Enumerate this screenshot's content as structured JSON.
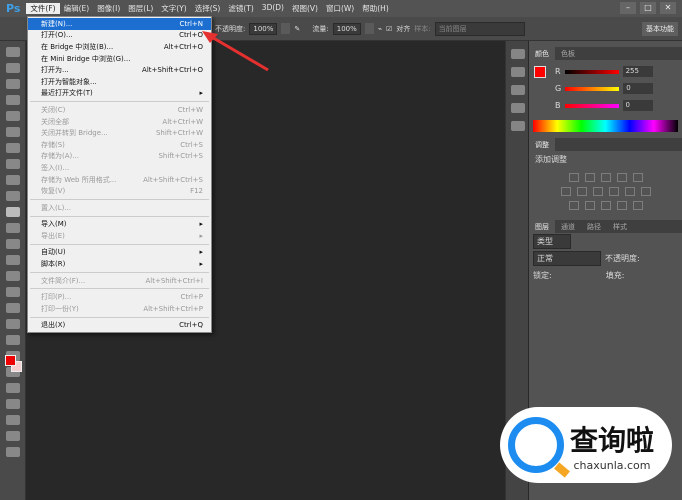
{
  "app": {
    "logo": "Ps"
  },
  "menubar": [
    "文件(F)",
    "编辑(E)",
    "图像(I)",
    "图层(L)",
    "文字(Y)",
    "选择(S)",
    "滤镜(T)",
    "3D(D)",
    "视图(V)",
    "窗口(W)",
    "帮助(H)"
  ],
  "window_buttons": [
    "–",
    "□",
    "✕"
  ],
  "options": {
    "opacity_label": "不透明度:",
    "opacity": "100%",
    "flow_label": "流量:",
    "flow": "100%",
    "align": "对齐",
    "sample_label": "样本:",
    "sample": "当前图层",
    "workspace": "基本功能"
  },
  "file_menu": [
    {
      "label": "新建(N)...",
      "shortcut": "Ctrl+N",
      "state": "highlight"
    },
    {
      "label": "打开(O)...",
      "shortcut": "Ctrl+O"
    },
    {
      "label": "在 Bridge 中浏览(B)...",
      "shortcut": "Alt+Ctrl+O"
    },
    {
      "label": "在 Mini Bridge 中浏览(G)...",
      "shortcut": ""
    },
    {
      "label": "打开为...",
      "shortcut": "Alt+Shift+Ctrl+O"
    },
    {
      "label": "打开为智能对象...",
      "shortcut": ""
    },
    {
      "label": "最近打开文件(T)",
      "shortcut": "▸"
    },
    {
      "sep": true
    },
    {
      "label": "关闭(C)",
      "shortcut": "Ctrl+W",
      "state": "disabled"
    },
    {
      "label": "关闭全部",
      "shortcut": "Alt+Ctrl+W",
      "state": "disabled"
    },
    {
      "label": "关闭并转到 Bridge...",
      "shortcut": "Shift+Ctrl+W",
      "state": "disabled"
    },
    {
      "label": "存储(S)",
      "shortcut": "Ctrl+S",
      "state": "disabled"
    },
    {
      "label": "存储为(A)...",
      "shortcut": "Shift+Ctrl+S",
      "state": "disabled"
    },
    {
      "label": "签入(I)...",
      "shortcut": "",
      "state": "disabled"
    },
    {
      "label": "存储为 Web 所用格式...",
      "shortcut": "Alt+Shift+Ctrl+S",
      "state": "disabled"
    },
    {
      "label": "恢复(V)",
      "shortcut": "F12",
      "state": "disabled"
    },
    {
      "sep": true
    },
    {
      "label": "置入(L)...",
      "shortcut": "",
      "state": "disabled"
    },
    {
      "sep": true
    },
    {
      "label": "导入(M)",
      "shortcut": "▸"
    },
    {
      "label": "导出(E)",
      "shortcut": "▸",
      "state": "disabled"
    },
    {
      "sep": true
    },
    {
      "label": "自动(U)",
      "shortcut": "▸"
    },
    {
      "label": "脚本(R)",
      "shortcut": "▸"
    },
    {
      "sep": true
    },
    {
      "label": "文件简介(F)...",
      "shortcut": "Alt+Shift+Ctrl+I",
      "state": "disabled"
    },
    {
      "sep": true
    },
    {
      "label": "打印(P)...",
      "shortcut": "Ctrl+P",
      "state": "disabled"
    },
    {
      "label": "打印一份(Y)",
      "shortcut": "Alt+Shift+Ctrl+P",
      "state": "disabled"
    },
    {
      "sep": true
    },
    {
      "label": "退出(X)",
      "shortcut": "Ctrl+Q"
    }
  ],
  "color_panel": {
    "tabs": [
      "颜色",
      "色板"
    ],
    "r_label": "R",
    "g_label": "G",
    "b_label": "B",
    "r": "255",
    "g": "0",
    "b": "0",
    "fg": "#ff0000",
    "bg": "#f8d8d8"
  },
  "adjust_panel": {
    "tab": "调整",
    "title": "添加调整"
  },
  "layers_panel": {
    "tabs": [
      "图层",
      "通道",
      "路径",
      "样式"
    ],
    "kind": "类型",
    "blend": "正常",
    "opacity_label": "不透明度:",
    "lock_label": "锁定:",
    "fill_label": "填充:"
  },
  "watermark": {
    "title": "查询啦",
    "url": "chaxunla.com"
  }
}
